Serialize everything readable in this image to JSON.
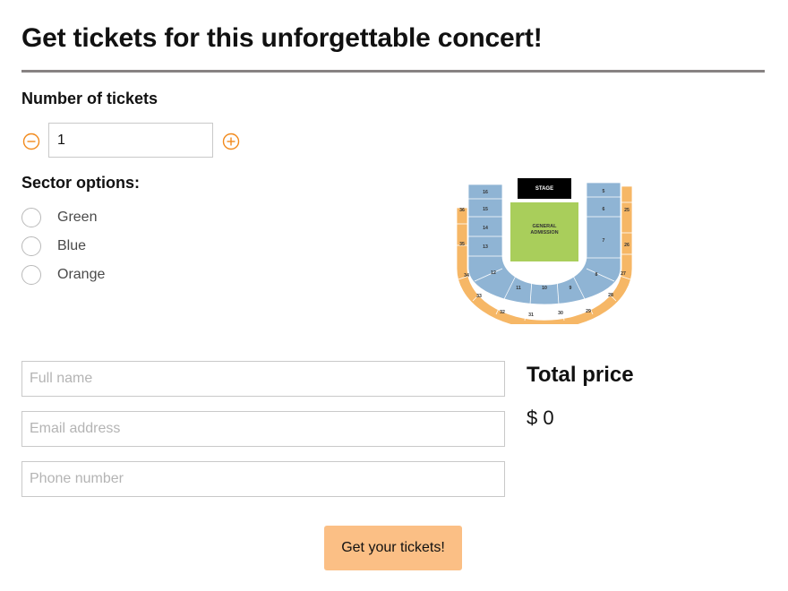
{
  "page": {
    "title": "Get tickets for this unforgettable concert!"
  },
  "tickets": {
    "label": "Number of tickets",
    "value": "1",
    "decrement_icon": "minus-circle-icon",
    "increment_icon": "plus-circle-icon"
  },
  "sectors": {
    "label": "Sector options:",
    "options": [
      "Green",
      "Blue",
      "Orange"
    ]
  },
  "seat_map": {
    "stage": "STAGE",
    "general_admission_line1": "GENERAL",
    "general_admission_line2": "ADMISSION",
    "left_column": [
      "16",
      "15",
      "14",
      "13"
    ],
    "right_column": [
      "5",
      "6",
      "7"
    ],
    "left_outer": [
      "36",
      "35"
    ],
    "right_outer": [
      "25",
      "26"
    ],
    "inner_ring": [
      "12",
      "11",
      "10",
      "9",
      "8"
    ],
    "outer_ring": [
      "34",
      "33",
      "32",
      "31",
      "30",
      "29",
      "28",
      "27"
    ],
    "colors": {
      "blue": "#8fb4d4",
      "green": "#a9ce5b",
      "orange": "#f6b766",
      "stage": "#000000"
    }
  },
  "form": {
    "full_name_placeholder": "Full name",
    "email_placeholder": "Email address",
    "phone_placeholder": "Phone number",
    "submit_label": "Get your tickets!"
  },
  "total": {
    "heading": "Total price",
    "currency": "$",
    "amount": "0"
  },
  "colors": {
    "accent": "#f28a1c",
    "button": "#fbbf85",
    "rule": "#878282"
  }
}
